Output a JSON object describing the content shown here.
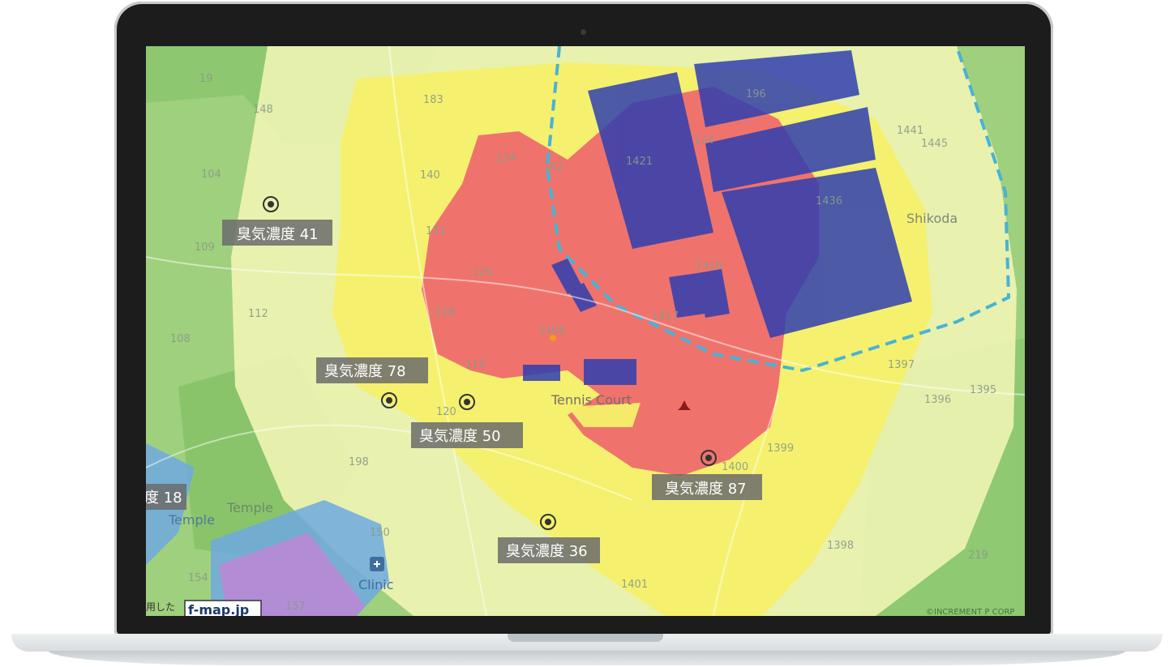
{
  "map": {
    "place_labels": [
      "Shikoda",
      "Tennis Court",
      "Temple",
      "Temple",
      "Clinic"
    ],
    "block_numbers": [
      "19",
      "148",
      "104",
      "109",
      "112",
      "108",
      "183",
      "140",
      "134",
      "131",
      "129",
      "128",
      "119",
      "120",
      "198",
      "154",
      "157",
      "150",
      "1441",
      "1445",
      "1436",
      "1408",
      "1416",
      "1417",
      "1399",
      "1400",
      "1396",
      "1395",
      "1397",
      "1398",
      "1401",
      "219",
      "196",
      "142",
      "124",
      "1421"
    ],
    "sensor_labels": [
      {
        "prefix": "臭気濃度",
        "value": "41"
      },
      {
        "prefix": "臭気濃度",
        "value": "78"
      },
      {
        "prefix": "臭気濃度",
        "value": "50"
      },
      {
        "prefix": "臭気濃度",
        "value": "87"
      },
      {
        "prefix": "臭気濃度",
        "value": "36"
      },
      {
        "prefix": "度",
        "value": "18"
      }
    ],
    "logo_text": "f-map.jp",
    "clipped_text": "用した",
    "copyright": "©INCREMENT P CORP"
  }
}
